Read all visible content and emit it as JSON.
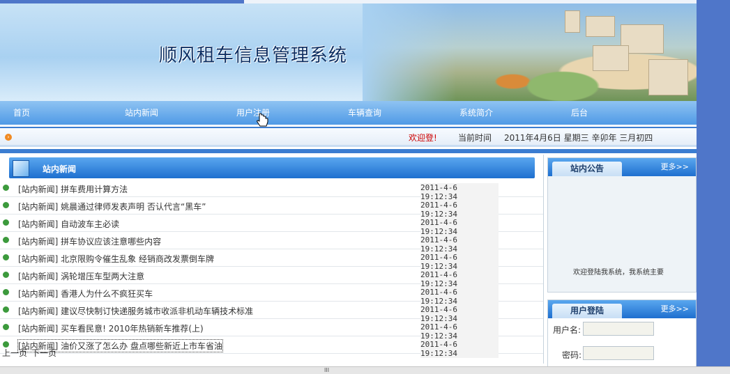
{
  "site": {
    "title": "顺风租车信息管理系统"
  },
  "nav": {
    "items": [
      {
        "label": "首页"
      },
      {
        "label": "站内新闻"
      },
      {
        "label": "用户注册"
      },
      {
        "label": "车辆查询"
      },
      {
        "label": "系统简介"
      },
      {
        "label": "后台"
      }
    ]
  },
  "info_bar": {
    "welcome": "欢迎登!",
    "time_label": "当前时间",
    "time_value": "2011年4月6日 星期三 辛卯年 三月初四"
  },
  "news": {
    "heading": "站内新闻",
    "items": [
      {
        "title": "[站内新闻] 拼车费用计算方法",
        "date": "2011-4-6 19:12:34"
      },
      {
        "title": "[站内新闻] 姚晨通过律师发表声明 否认代言“黑车”",
        "date": "2011-4-6 19:12:34"
      },
      {
        "title": "[站内新闻] 自动波车主必读",
        "date": "2011-4-6 19:12:34"
      },
      {
        "title": "[站内新闻] 拼车协议应该注意哪些内容",
        "date": "2011-4-6 19:12:34"
      },
      {
        "title": "[站内新闻] 北京限购令催生乱象 经销商改发票倒车牌",
        "date": "2011-4-6 19:12:34"
      },
      {
        "title": "[站内新闻] 涡轮增压车型两大注意",
        "date": "2011-4-6 19:12:34"
      },
      {
        "title": "[站内新闻] 香港人为什么不疯狂买车",
        "date": "2011-4-6 19:12:34"
      },
      {
        "title": "[站内新闻] 建议尽快制订快递服务城市收派非机动车辆技术标准",
        "date": "2011-4-6 19:12:34"
      },
      {
        "title": "[站内新闻] 买车看民意! 2010年热销新车推荐(上)",
        "date": "2011-4-6 19:12:34"
      },
      {
        "title": "[站内新闻] 油价又涨了怎么办 盘点哪些新近上市车省油",
        "date": "2011-4-6 19:12:34"
      }
    ],
    "prev_label": "上一页",
    "next_label": "下一页"
  },
  "notice": {
    "heading": "站内公告",
    "more": "更多>>",
    "marquee_text": "欢迎登陆我系统，我系统主要"
  },
  "login": {
    "heading": "用户登陆",
    "more": "更多>>",
    "username_label": "用户名:",
    "password_label": "密码:"
  },
  "scrollbar": {
    "grip": "III"
  }
}
